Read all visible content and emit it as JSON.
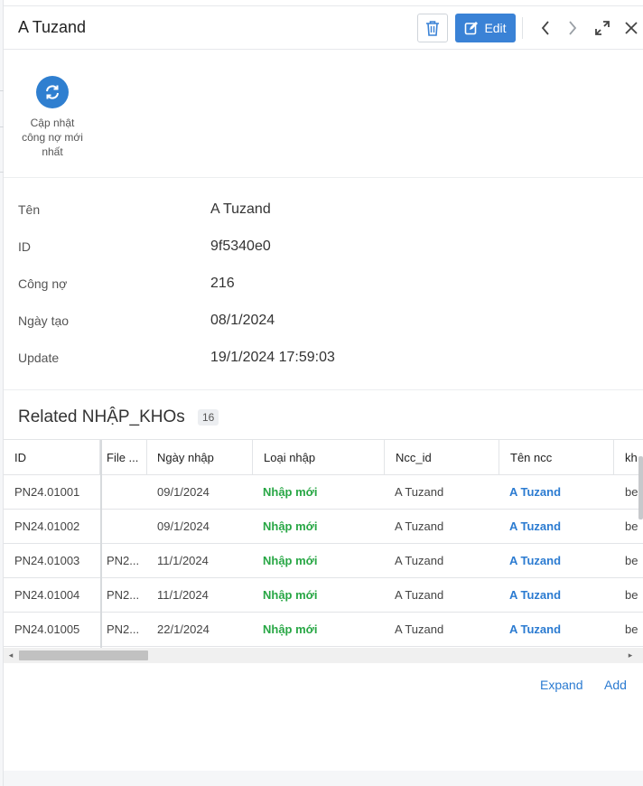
{
  "header": {
    "title": "A Tuzand",
    "edit_label": "Edit"
  },
  "actions": {
    "update_debt_label": "Cập nhật công nợ mới nhất"
  },
  "details": [
    {
      "label": "Tên",
      "value": "A Tuzand"
    },
    {
      "label": "ID",
      "value": "9f5340e0"
    },
    {
      "label": "Công nợ",
      "value": "216"
    },
    {
      "label": "Ngày tạo",
      "value": "08/1/2024"
    },
    {
      "label": "Update",
      "value": "19/1/2024 17:59:03"
    }
  ],
  "related": {
    "title": "Related NHẬP_KHOs",
    "count": "16",
    "columns": [
      "ID",
      "File ...",
      "Ngày nhập",
      "Loại nhập",
      "Ncc_id",
      "Tên ncc",
      "kh"
    ],
    "rows": [
      {
        "id": "PN24.01001",
        "file": "",
        "date": "09/1/2024",
        "type": "Nhập mới",
        "ncc_id": "A Tuzand",
        "ncc_name": "A Tuzand",
        "extra": "be"
      },
      {
        "id": "PN24.01002",
        "file": "",
        "date": "09/1/2024",
        "type": "Nhập mới",
        "ncc_id": "A Tuzand",
        "ncc_name": "A Tuzand",
        "extra": "be"
      },
      {
        "id": "PN24.01003",
        "file": "PN2...",
        "date": "11/1/2024",
        "type": "Nhập mới",
        "ncc_id": "A Tuzand",
        "ncc_name": "A Tuzand",
        "extra": "be"
      },
      {
        "id": "PN24.01004",
        "file": "PN2...",
        "date": "11/1/2024",
        "type": "Nhập mới",
        "ncc_id": "A Tuzand",
        "ncc_name": "A Tuzand",
        "extra": "be"
      },
      {
        "id": "PN24.01005",
        "file": "PN2...",
        "date": "22/1/2024",
        "type": "Nhập mới",
        "ncc_id": "A Tuzand",
        "ncc_name": "A Tuzand",
        "extra": "be"
      }
    ],
    "expand_label": "Expand",
    "add_label": "Add"
  },
  "colors": {
    "accent": "#3a82d6",
    "link": "#2b7bd1",
    "status_green": "#28a745"
  },
  "icons": [
    "trash-icon",
    "edit-icon",
    "chevron-left-icon",
    "chevron-right-icon",
    "expand-icon",
    "close-icon",
    "refresh-icon"
  ]
}
